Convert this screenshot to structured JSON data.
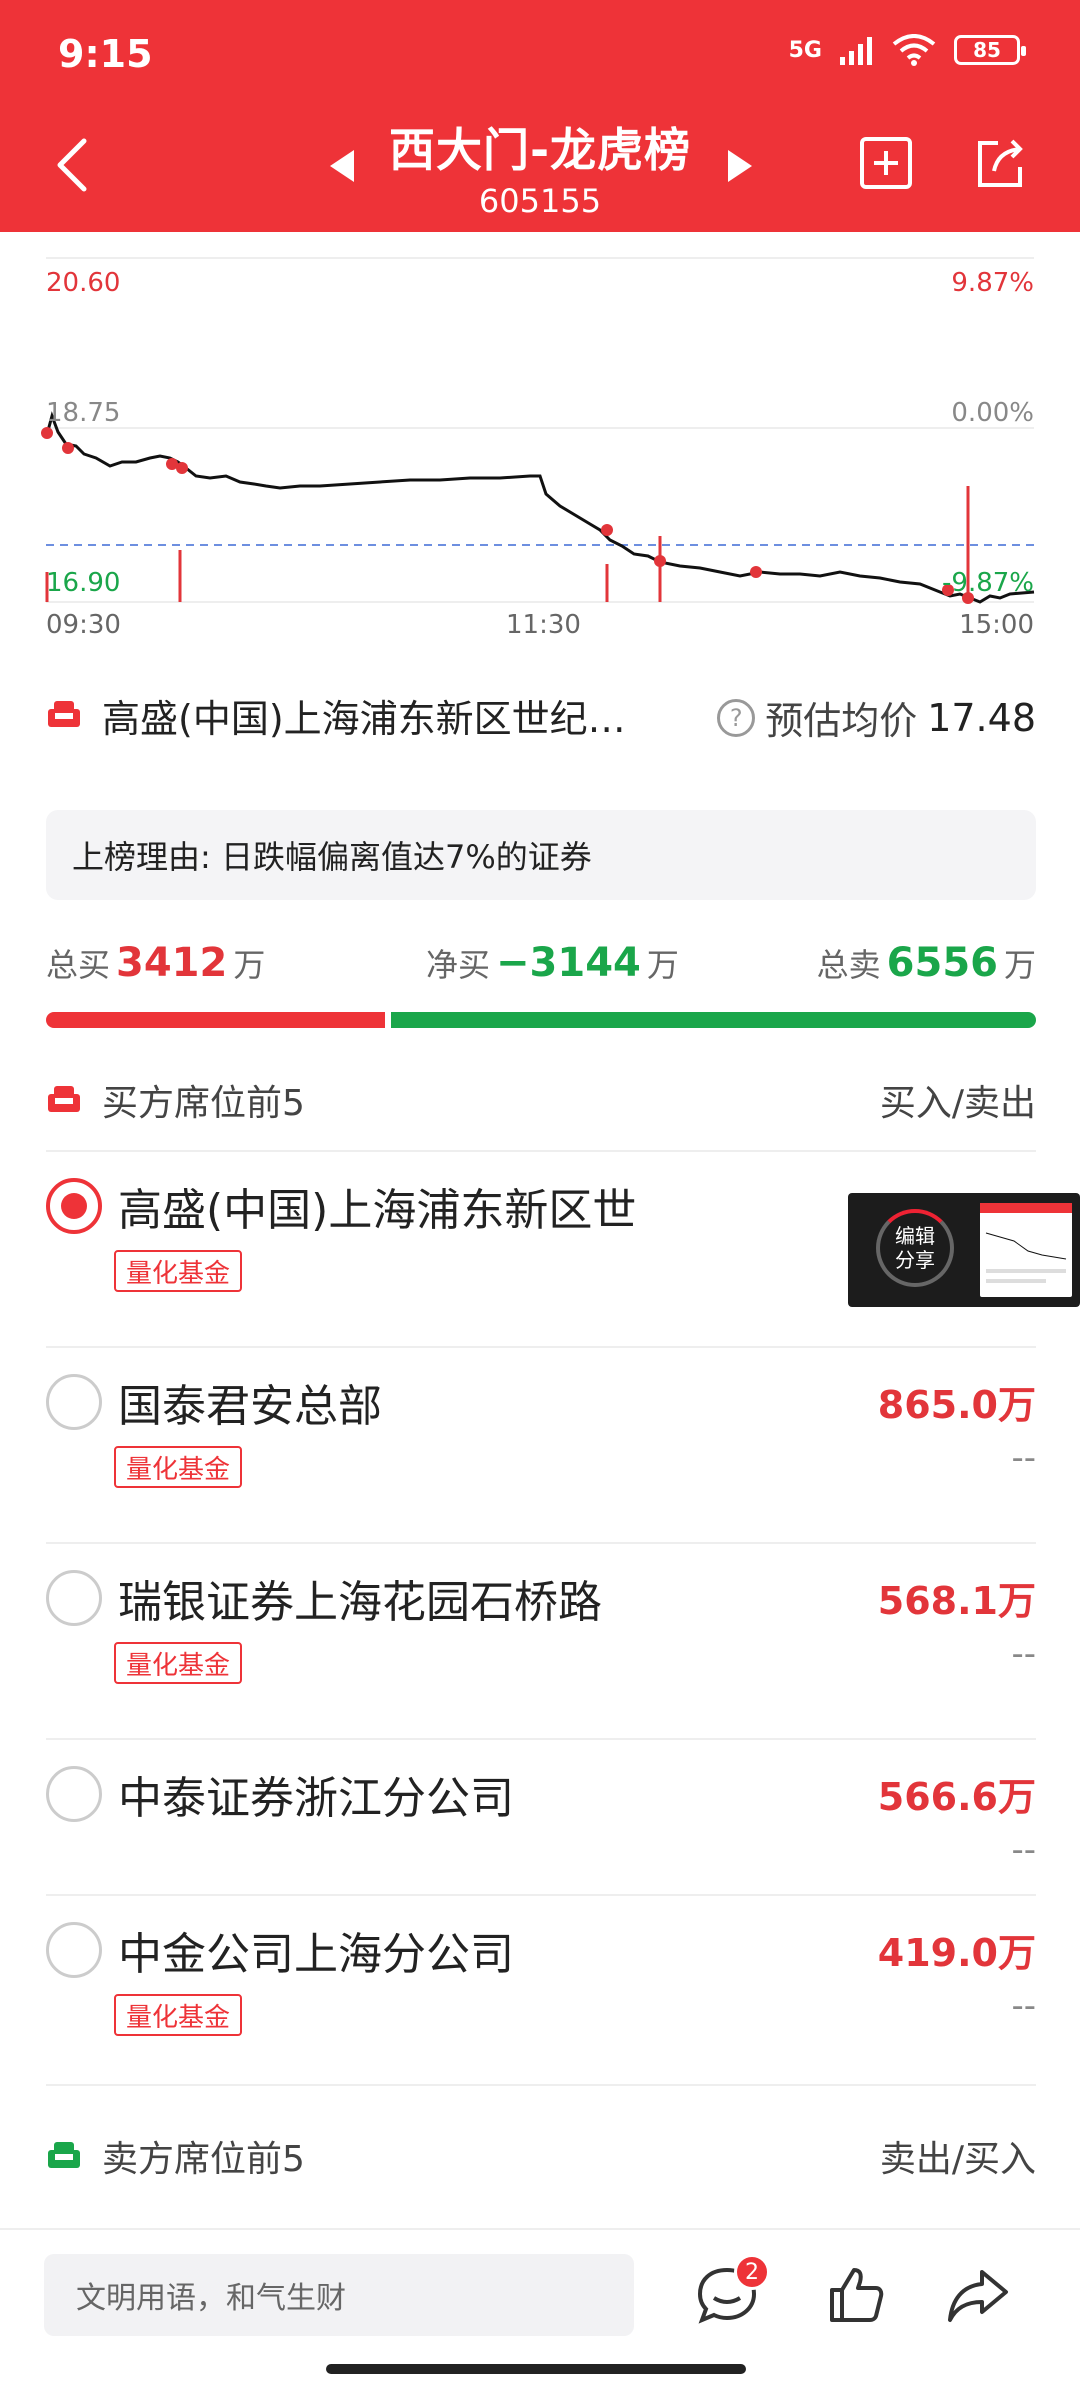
{
  "status_bar": {
    "time": "9:15",
    "network": "5G",
    "battery": "85"
  },
  "header": {
    "title": "西大门-龙虎榜",
    "code": "605155"
  },
  "chart": {
    "price_top": "20.60",
    "pct_top": "9.87%",
    "price_mid": "18.75",
    "pct_mid": "0.00%",
    "price_bottom": "16.90",
    "pct_bottom": "-9.87%",
    "time_start": "09:30",
    "time_mid": "11:30",
    "time_end": "15:00",
    "line_color": "#111111",
    "marker_color": "#e2353a",
    "avg_line_color": "#6d8fe0"
  },
  "summary": {
    "broker": "高盛(中国)上海浦东新区世纪…",
    "est_label": "预估均价",
    "est_value": "17.48"
  },
  "reason": "上榜理由: 日跌幅偏离值达7%的证券",
  "totals": {
    "buy_label": "总买",
    "buy_value": "3412",
    "buy_unit": "万",
    "net_label": "净买",
    "net_value": "−3144",
    "net_unit": "万",
    "sell_label": "总卖",
    "sell_value": "6556",
    "sell_unit": "万",
    "buy_share": 0.342
  },
  "buy_section": {
    "title": "买方席位前5",
    "right": "买入/卖出"
  },
  "buy_seats": [
    {
      "name": "高盛(中国)上海浦东新区世",
      "tag": "量化基金",
      "amount": "",
      "sub": "",
      "selected": true
    },
    {
      "name": "国泰君安总部",
      "tag": "量化基金",
      "amount": "865.0万",
      "sub": "--",
      "selected": false
    },
    {
      "name": "瑞银证券上海花园石桥路",
      "tag": "量化基金",
      "amount": "568.1万",
      "sub": "--",
      "selected": false
    },
    {
      "name": "中泰证券浙江分公司",
      "tag": "",
      "amount": "566.6万",
      "sub": "--",
      "selected": false
    },
    {
      "name": "中金公司上海分公司",
      "tag": "量化基金",
      "amount": "419.0万",
      "sub": "--",
      "selected": false
    }
  ],
  "float_card": {
    "label": "编辑\n分享"
  },
  "sell_section": {
    "title": "卖方席位前5",
    "right": "卖出/买入"
  },
  "bottom": {
    "placeholder": "文明用语，和气生财",
    "comment_count": "2"
  },
  "colors": {
    "brand_red": "#ee3338",
    "green": "#1aa64a"
  }
}
